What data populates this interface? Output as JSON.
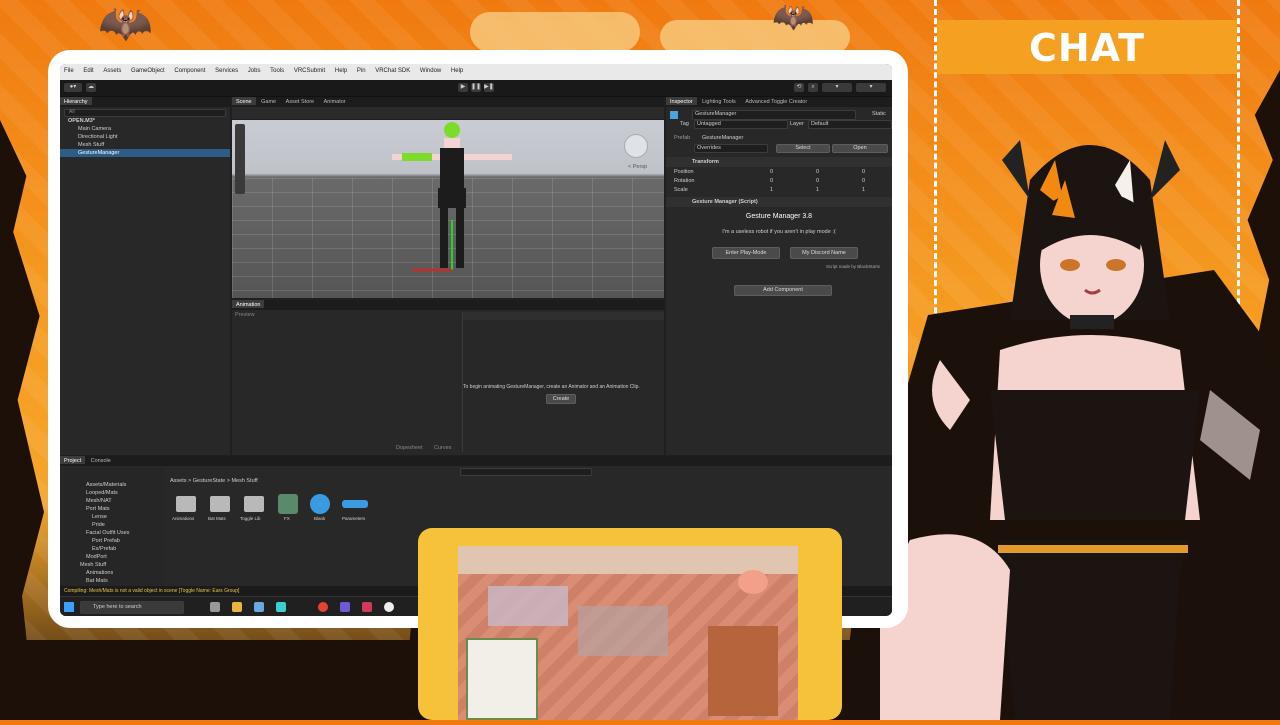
{
  "stream": {
    "chat_title": "CHAT"
  },
  "unity": {
    "menu": [
      "File",
      "Edit",
      "Assets",
      "GameObject",
      "Component",
      "Services",
      "Jobs",
      "Tools",
      "VRCSubmit",
      "Help",
      "Pin",
      "VRChat SDK",
      "Window",
      "Help"
    ],
    "hierarchy": {
      "tab": "Hierarchy",
      "search_placeholder": "All",
      "items": [
        "OPEN.M3*",
        "Main Camera",
        "Directional Light",
        "Mesh Stuff",
        "GestureManager"
      ]
    },
    "scene": {
      "tabs": [
        "Scene",
        "Game",
        "Asset Store",
        "Animator"
      ],
      "persp_label": "< Persp"
    },
    "animation": {
      "tab": "Animation",
      "preview_label": "Preview",
      "message": "To begin animating GestureManager, create an Animator and an Animation Clip.",
      "create_button": "Create",
      "bottom_tabs": [
        "Dopesheet",
        "Curves"
      ]
    },
    "inspector": {
      "tabs": [
        "Inspector",
        "Lighting Tools",
        "Advanced Toggle Creator"
      ],
      "object_name": "GestureManager",
      "static_label": "Static",
      "tag_label": "Tag",
      "tag_value": "Untagged",
      "layer_label": "Layer",
      "layer_value": "Default",
      "prefab_label": "Prefab",
      "prefab_name": "GestureManager",
      "overrides_label": "Overrides",
      "select_label": "Select",
      "open_label": "Open",
      "transform_title": "Transform",
      "rows": [
        {
          "label": "Position",
          "x": "0",
          "y": "0",
          "z": "0"
        },
        {
          "label": "Rotation",
          "x": "0",
          "y": "0",
          "z": "0"
        },
        {
          "label": "Scale",
          "x": "1",
          "y": "1",
          "z": "1"
        }
      ],
      "component_title": "Gesture Manager (Script)",
      "gm_heading": "Gesture Manager 3.8",
      "gm_subtitle": "I'm a useless robot if you aren't in play mode :(",
      "enter_play_button": "Enter Play-Mode",
      "discord_button": "My Discord Name",
      "script_by": "Script made by BlackStartx",
      "add_component_button": "Add Component"
    },
    "project": {
      "tabs": [
        "Project",
        "Console"
      ],
      "breadcrumb": "Assets > GestureState > Mesh Stuff",
      "tree": [
        "Assets/Materials",
        "Looped/Mats",
        "Mesh/NAT",
        "Port Mats",
        "Lense",
        "Pride",
        "Facial Outfit Uses",
        "Port Prefab",
        "Ex/Prefab",
        "ModPort",
        "Mesh Stuff",
        "Animations",
        "Bat Mats"
      ],
      "assets": [
        {
          "label": "Animations",
          "kind": "folder"
        },
        {
          "label": "Bat Mats",
          "kind": "folder"
        },
        {
          "label": "Toggle Lib",
          "kind": "folder"
        },
        {
          "label": "FX",
          "kind": "controller"
        },
        {
          "label": "Blank",
          "kind": "sphere"
        },
        {
          "label": "Parameters",
          "kind": "params"
        }
      ]
    },
    "status_message": "Compiling: Mesh/Mats is not a valid object in scene [Toggle Name: Ears Group]",
    "taskbar": {
      "search_placeholder": "Type here to search"
    }
  },
  "colors": {
    "accent_orange": "#f07a10",
    "unity_dark": "#1f1f1f",
    "selection_blue": "#2c5d87",
    "game_frame": "#f6c23a"
  }
}
